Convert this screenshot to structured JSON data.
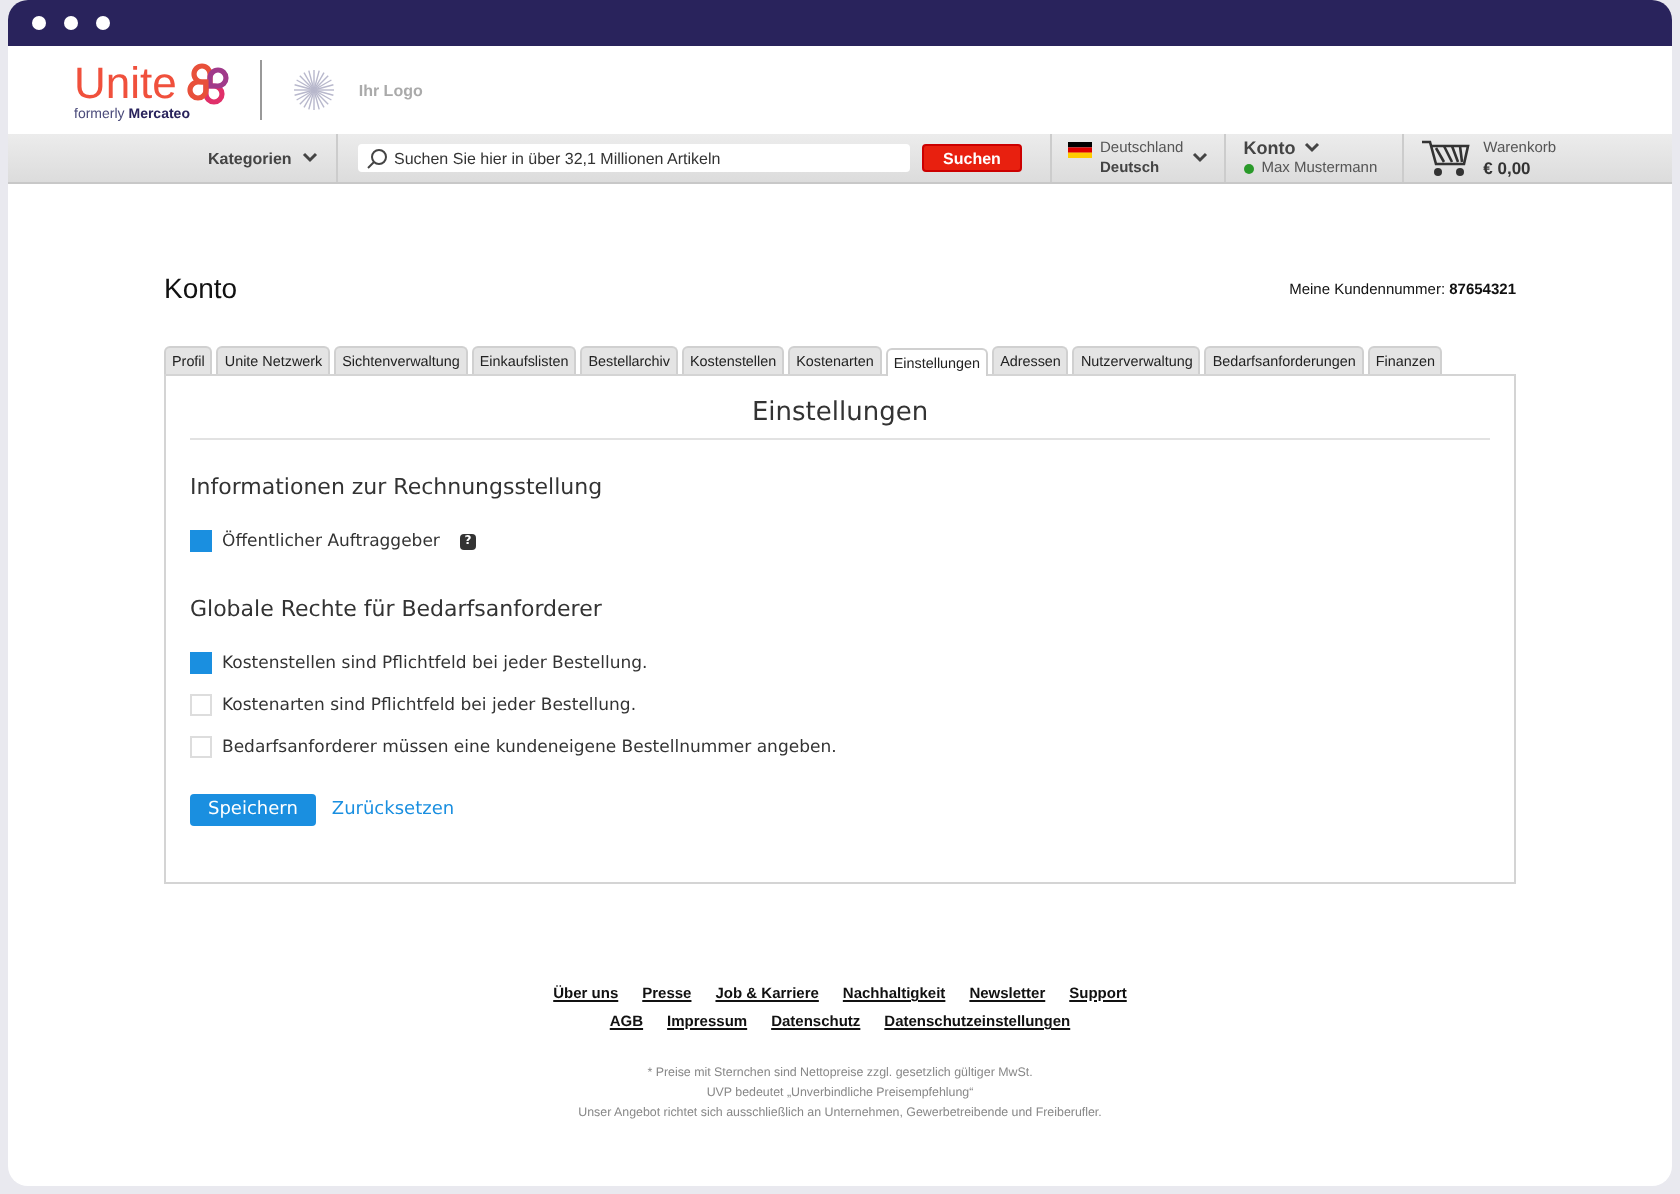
{
  "brand": {
    "name": "Unite",
    "tagline_prefix": "formerly",
    "tagline_brand": "Mercateo",
    "partner_logo": "Ihr Logo"
  },
  "navbar": {
    "categories": "Kategorien",
    "search": {
      "placeholder": "Suchen Sie hier in über 32,1 Millionen Artikeln"
    },
    "search_button": "Suchen",
    "country": "Deutschland",
    "language": "Deutsch",
    "account": "Konto",
    "user": "Max Mustermann",
    "user_online": true,
    "cart_label": "Warenkorb",
    "cart_total": "€ 0,00"
  },
  "page": {
    "title": "Konto",
    "customer_label": "Meine Kundennummer:",
    "customer_number": "87654321"
  },
  "tabs": [
    {
      "label": "Profil",
      "selected": false
    },
    {
      "label": "Unite Netzwerk",
      "selected": false
    },
    {
      "label": "Sichtenverwaltung",
      "selected": false
    },
    {
      "label": "Einkaufslisten",
      "selected": false
    },
    {
      "label": "Bestellarchiv",
      "selected": false
    },
    {
      "label": "Kostenstellen",
      "selected": false
    },
    {
      "label": "Kostenarten",
      "selected": false
    },
    {
      "label": "Einstellungen",
      "selected": true
    },
    {
      "label": "Adressen",
      "selected": false
    },
    {
      "label": "Nutzerverwaltung",
      "selected": false
    },
    {
      "label": "Bedarfsanforderungen",
      "selected": false
    },
    {
      "label": "Finanzen",
      "selected": false
    }
  ],
  "panel": {
    "title": "Einstellungen",
    "sections": [
      {
        "heading": "Informationen zur Rechnungsstellung",
        "options": [
          {
            "label": "Öffentlicher Auftraggeber",
            "checked": true,
            "help": "?"
          }
        ]
      },
      {
        "heading": "Globale Rechte für Bedarfsanforderer",
        "options": [
          {
            "label": "Kostenstellen sind Pflichtfeld bei jeder Bestellung.",
            "checked": true
          },
          {
            "label": "Kostenarten sind Pflichtfeld bei jeder Bestellung.",
            "checked": false
          },
          {
            "label": "Bedarfsanforderer müssen eine kundeneigene Bestellnummer angeben.",
            "checked": false
          }
        ]
      }
    ],
    "save_button": "Speichern",
    "reset_link": "Zurücksetzen"
  },
  "footer": {
    "link_rows": [
      [
        "Über uns",
        "Presse",
        "Job & Karriere",
        "Nachhaltigkeit",
        "Newsletter",
        "Support"
      ],
      [
        "AGB",
        "Impressum",
        "Datenschutz",
        "Datenschutzeinstellungen"
      ]
    ],
    "notes": [
      "* Preise mit Sternchen sind Nettopreise zzgl. gesetzlich gültiger MwSt.",
      "UVP bedeutet „Unverbindliche Preisempfehlung“",
      "Unser Angebot richtet sich ausschließlich an Unternehmen, Gewerbetreibende und Freiberufler."
    ]
  }
}
